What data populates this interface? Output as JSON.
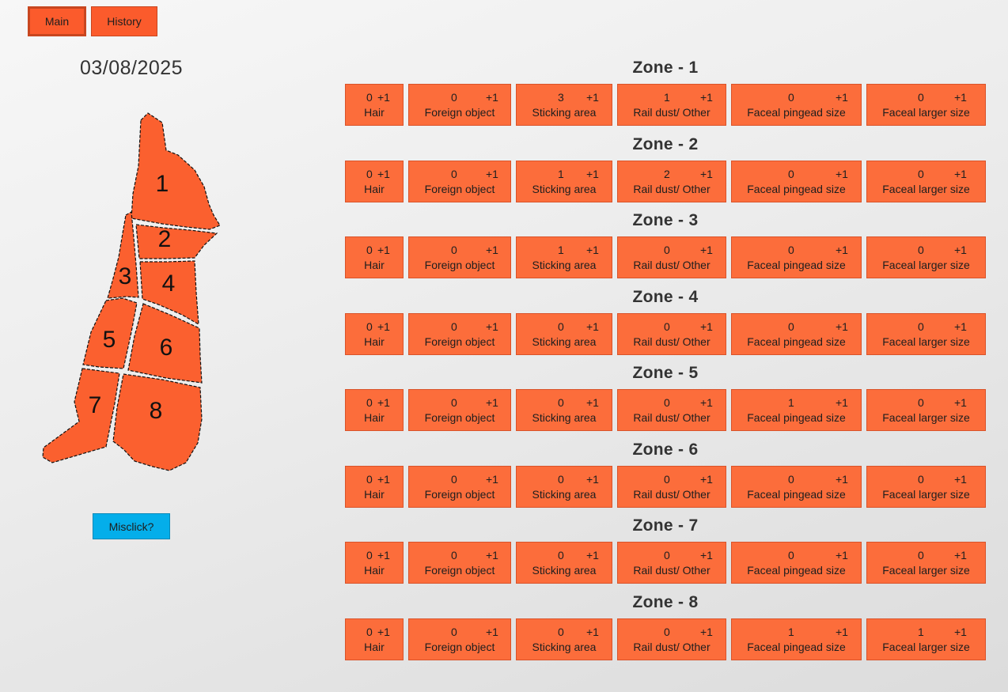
{
  "nav": {
    "main_label": "Main",
    "history_label": "History",
    "active": "Main"
  },
  "date": "03/08/2025",
  "map": {
    "zone_labels": [
      "1",
      "2",
      "3",
      "4",
      "5",
      "6",
      "7",
      "8"
    ]
  },
  "misclick_label": "Misclick?",
  "increment_label": "+1",
  "categories": [
    "Hair",
    "Foreign object",
    "Sticking area",
    "Rail dust/ Other",
    "Faceal pingead size",
    "Faceal larger size"
  ],
  "zones": [
    {
      "title": "Zone - 1",
      "counts": [
        0,
        0,
        3,
        1,
        0,
        0
      ]
    },
    {
      "title": "Zone - 2",
      "counts": [
        0,
        0,
        1,
        2,
        0,
        0
      ]
    },
    {
      "title": "Zone - 3",
      "counts": [
        0,
        0,
        1,
        0,
        0,
        0
      ]
    },
    {
      "title": "Zone - 4",
      "counts": [
        0,
        0,
        0,
        0,
        0,
        0
      ]
    },
    {
      "title": "Zone - 5",
      "counts": [
        0,
        0,
        0,
        0,
        1,
        0
      ]
    },
    {
      "title": "Zone - 6",
      "counts": [
        0,
        0,
        0,
        0,
        0,
        0
      ]
    },
    {
      "title": "Zone - 7",
      "counts": [
        0,
        0,
        0,
        0,
        0,
        0
      ]
    },
    {
      "title": "Zone - 8",
      "counts": [
        0,
        0,
        0,
        0,
        1,
        1
      ]
    }
  ],
  "colors": {
    "card": "#fc6d3b",
    "nav": "#fb5b2c",
    "misclick": "#04aeea",
    "map_fill": "#fb602f"
  }
}
